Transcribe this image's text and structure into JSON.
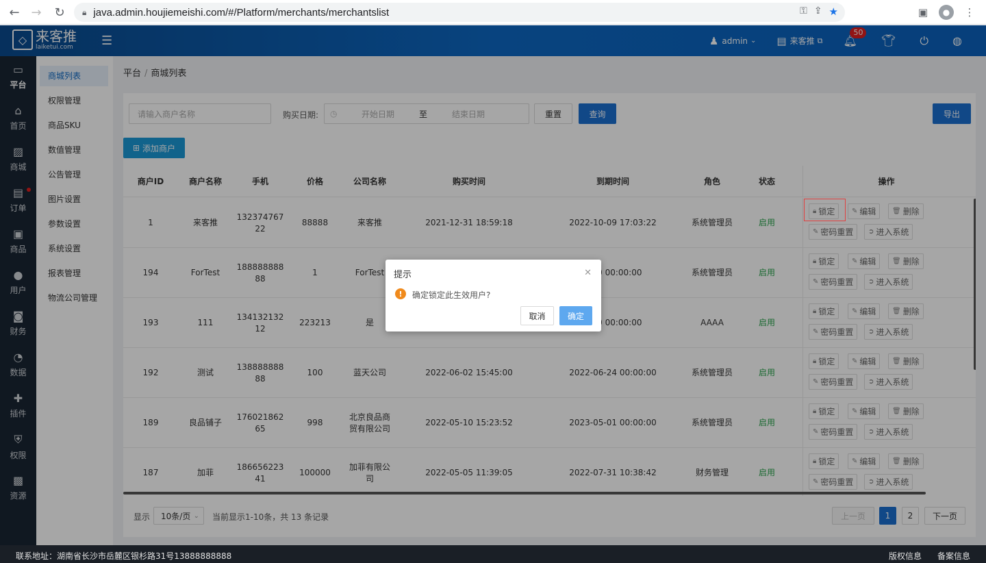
{
  "browser": {
    "url": "java.admin.houjiemeishi.com/#/Platform/merchants/merchantslist"
  },
  "header": {
    "logo_cn": "来客推",
    "logo_en": "laiketui.com",
    "user": "admin",
    "store": "来客推",
    "notifications": "50"
  },
  "leftnav": [
    {
      "label": "平台",
      "icon": "monitor-icon"
    },
    {
      "label": "首页",
      "icon": "home-icon"
    },
    {
      "label": "商城",
      "icon": "image-icon"
    },
    {
      "label": "订单",
      "icon": "clipboard-icon"
    },
    {
      "label": "商品",
      "icon": "box-icon"
    },
    {
      "label": "用户",
      "icon": "user-icon"
    },
    {
      "label": "财务",
      "icon": "wallet-icon"
    },
    {
      "label": "数据",
      "icon": "pie-icon"
    },
    {
      "label": "插件",
      "icon": "puzzle-icon"
    },
    {
      "label": "权限",
      "icon": "shield-icon"
    },
    {
      "label": "资源",
      "icon": "picture-icon"
    }
  ],
  "subnav": [
    "商城列表",
    "权限管理",
    "商品SKU",
    "数值管理",
    "公告管理",
    "图片设置",
    "参数设置",
    "系统设置",
    "报表管理",
    "物流公司管理"
  ],
  "breadcrumb": {
    "root": "平台",
    "sep": "/",
    "current": "商城列表"
  },
  "filter": {
    "merchant_placeholder": "请输入商户名称",
    "date_label": "购买日期:",
    "start_placeholder": "开始日期",
    "to": "至",
    "end_placeholder": "结束日期",
    "reset": "重置",
    "query": "查询",
    "export": "导出",
    "add": "添加商户"
  },
  "table": {
    "headers": [
      "商户ID",
      "商户名称",
      "手机",
      "价格",
      "公司名称",
      "购买时间",
      "到期时间",
      "角色",
      "状态",
      "操作"
    ],
    "rows": [
      {
        "id": "1",
        "name": "来客推",
        "phone": [
          "132374767",
          "22"
        ],
        "price": "88888",
        "company": [
          "来客推"
        ],
        "buy": "2021-12-31 18:59:18",
        "expire": "2022-10-09 17:03:22",
        "role": "系统管理员",
        "status": "启用"
      },
      {
        "id": "194",
        "name": "ForTest",
        "phone": [
          "188888888",
          "88"
        ],
        "price": "1",
        "company": [
          "ForTest"
        ],
        "buy": "",
        "expire": "6-30 00:00:00",
        "role": "系统管理员",
        "status": "启用"
      },
      {
        "id": "193",
        "name": "111",
        "phone": [
          "134132132",
          "12"
        ],
        "price": "223213",
        "company": [
          "是"
        ],
        "buy": "",
        "expire": "6-30 00:00:00",
        "role": "AAAA",
        "status": "启用"
      },
      {
        "id": "192",
        "name": "测试",
        "phone": [
          "138888888",
          "88"
        ],
        "price": "100",
        "company": [
          "蓝天公司"
        ],
        "buy": "2022-06-02 15:45:00",
        "expire": "2022-06-24 00:00:00",
        "role": "系统管理员",
        "status": "启用"
      },
      {
        "id": "189",
        "name": "良品铺子",
        "phone": [
          "176021862",
          "65"
        ],
        "price": "998",
        "company": [
          "北京良品商",
          "贸有限公司"
        ],
        "buy": "2022-05-10 15:23:52",
        "expire": "2023-05-01 00:00:00",
        "role": "系统管理员",
        "status": "启用"
      },
      {
        "id": "187",
        "name": "加菲",
        "phone": [
          "186656223",
          "41"
        ],
        "price": "100000",
        "company": [
          "加菲有限公",
          "司"
        ],
        "buy": "2022-05-05 11:39:05",
        "expire": "2022-07-31 10:38:42",
        "role": "财务管理",
        "status": "启用"
      }
    ],
    "ops": {
      "lock": "锁定",
      "edit": "编辑",
      "delete": "删除",
      "reset_pwd": "密码重置",
      "enter": "进入系统"
    }
  },
  "pager": {
    "show": "显示",
    "per_page": "10条/页",
    "summary": "当前显示1-10条，共 13 条记录",
    "prev": "上一页",
    "pages": [
      "1",
      "2"
    ],
    "next": "下一页"
  },
  "footer": {
    "address": "联系地址：湖南省长沙市岳麓区银杉路31号13888888888",
    "copyright": "版权信息",
    "icp": "备案信息"
  },
  "dialog": {
    "title": "提示",
    "message": "确定锁定此生效用户?",
    "cancel": "取消",
    "ok": "确定"
  }
}
